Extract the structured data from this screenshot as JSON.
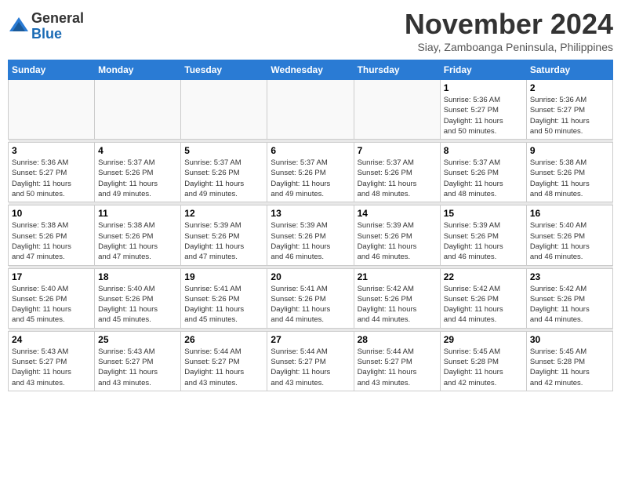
{
  "header": {
    "logo_line1": "General",
    "logo_line2": "Blue",
    "month_year": "November 2024",
    "location": "Siay, Zamboanga Peninsula, Philippines"
  },
  "days_of_week": [
    "Sunday",
    "Monday",
    "Tuesday",
    "Wednesday",
    "Thursday",
    "Friday",
    "Saturday"
  ],
  "weeks": [
    [
      {
        "day": "",
        "info": ""
      },
      {
        "day": "",
        "info": ""
      },
      {
        "day": "",
        "info": ""
      },
      {
        "day": "",
        "info": ""
      },
      {
        "day": "",
        "info": ""
      },
      {
        "day": "1",
        "info": "Sunrise: 5:36 AM\nSunset: 5:27 PM\nDaylight: 11 hours\nand 50 minutes."
      },
      {
        "day": "2",
        "info": "Sunrise: 5:36 AM\nSunset: 5:27 PM\nDaylight: 11 hours\nand 50 minutes."
      }
    ],
    [
      {
        "day": "3",
        "info": "Sunrise: 5:36 AM\nSunset: 5:27 PM\nDaylight: 11 hours\nand 50 minutes."
      },
      {
        "day": "4",
        "info": "Sunrise: 5:37 AM\nSunset: 5:26 PM\nDaylight: 11 hours\nand 49 minutes."
      },
      {
        "day": "5",
        "info": "Sunrise: 5:37 AM\nSunset: 5:26 PM\nDaylight: 11 hours\nand 49 minutes."
      },
      {
        "day": "6",
        "info": "Sunrise: 5:37 AM\nSunset: 5:26 PM\nDaylight: 11 hours\nand 49 minutes."
      },
      {
        "day": "7",
        "info": "Sunrise: 5:37 AM\nSunset: 5:26 PM\nDaylight: 11 hours\nand 48 minutes."
      },
      {
        "day": "8",
        "info": "Sunrise: 5:37 AM\nSunset: 5:26 PM\nDaylight: 11 hours\nand 48 minutes."
      },
      {
        "day": "9",
        "info": "Sunrise: 5:38 AM\nSunset: 5:26 PM\nDaylight: 11 hours\nand 48 minutes."
      }
    ],
    [
      {
        "day": "10",
        "info": "Sunrise: 5:38 AM\nSunset: 5:26 PM\nDaylight: 11 hours\nand 47 minutes."
      },
      {
        "day": "11",
        "info": "Sunrise: 5:38 AM\nSunset: 5:26 PM\nDaylight: 11 hours\nand 47 minutes."
      },
      {
        "day": "12",
        "info": "Sunrise: 5:39 AM\nSunset: 5:26 PM\nDaylight: 11 hours\nand 47 minutes."
      },
      {
        "day": "13",
        "info": "Sunrise: 5:39 AM\nSunset: 5:26 PM\nDaylight: 11 hours\nand 46 minutes."
      },
      {
        "day": "14",
        "info": "Sunrise: 5:39 AM\nSunset: 5:26 PM\nDaylight: 11 hours\nand 46 minutes."
      },
      {
        "day": "15",
        "info": "Sunrise: 5:39 AM\nSunset: 5:26 PM\nDaylight: 11 hours\nand 46 minutes."
      },
      {
        "day": "16",
        "info": "Sunrise: 5:40 AM\nSunset: 5:26 PM\nDaylight: 11 hours\nand 46 minutes."
      }
    ],
    [
      {
        "day": "17",
        "info": "Sunrise: 5:40 AM\nSunset: 5:26 PM\nDaylight: 11 hours\nand 45 minutes."
      },
      {
        "day": "18",
        "info": "Sunrise: 5:40 AM\nSunset: 5:26 PM\nDaylight: 11 hours\nand 45 minutes."
      },
      {
        "day": "19",
        "info": "Sunrise: 5:41 AM\nSunset: 5:26 PM\nDaylight: 11 hours\nand 45 minutes."
      },
      {
        "day": "20",
        "info": "Sunrise: 5:41 AM\nSunset: 5:26 PM\nDaylight: 11 hours\nand 44 minutes."
      },
      {
        "day": "21",
        "info": "Sunrise: 5:42 AM\nSunset: 5:26 PM\nDaylight: 11 hours\nand 44 minutes."
      },
      {
        "day": "22",
        "info": "Sunrise: 5:42 AM\nSunset: 5:26 PM\nDaylight: 11 hours\nand 44 minutes."
      },
      {
        "day": "23",
        "info": "Sunrise: 5:42 AM\nSunset: 5:26 PM\nDaylight: 11 hours\nand 44 minutes."
      }
    ],
    [
      {
        "day": "24",
        "info": "Sunrise: 5:43 AM\nSunset: 5:27 PM\nDaylight: 11 hours\nand 43 minutes."
      },
      {
        "day": "25",
        "info": "Sunrise: 5:43 AM\nSunset: 5:27 PM\nDaylight: 11 hours\nand 43 minutes."
      },
      {
        "day": "26",
        "info": "Sunrise: 5:44 AM\nSunset: 5:27 PM\nDaylight: 11 hours\nand 43 minutes."
      },
      {
        "day": "27",
        "info": "Sunrise: 5:44 AM\nSunset: 5:27 PM\nDaylight: 11 hours\nand 43 minutes."
      },
      {
        "day": "28",
        "info": "Sunrise: 5:44 AM\nSunset: 5:27 PM\nDaylight: 11 hours\nand 43 minutes."
      },
      {
        "day": "29",
        "info": "Sunrise: 5:45 AM\nSunset: 5:28 PM\nDaylight: 11 hours\nand 42 minutes."
      },
      {
        "day": "30",
        "info": "Sunrise: 5:45 AM\nSunset: 5:28 PM\nDaylight: 11 hours\nand 42 minutes."
      }
    ]
  ]
}
